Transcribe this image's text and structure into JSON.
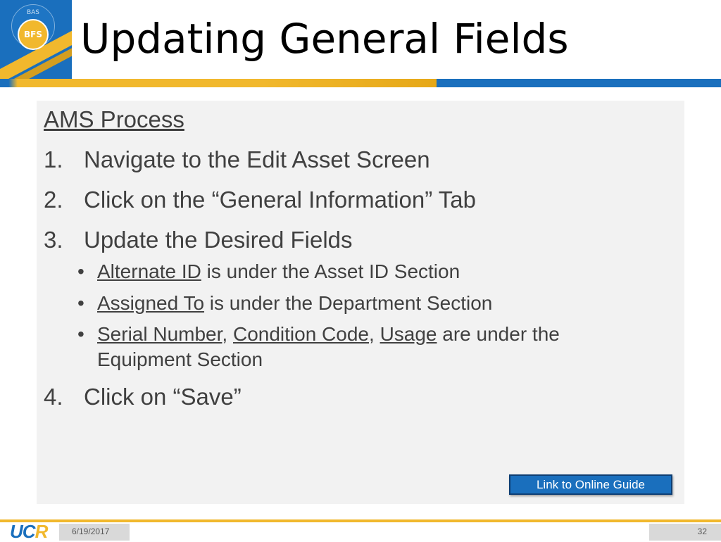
{
  "logo": {
    "small_text": "BAS",
    "badge_text": "BFS"
  },
  "slide": {
    "title": "Updating General Fields",
    "heading": "AMS Process",
    "steps": [
      {
        "num": "1.",
        "text": "Navigate to the Edit Asset Screen"
      },
      {
        "num": "2.",
        "text": "Click on the “General Information” Tab"
      },
      {
        "num": "3.",
        "text": "Update the Desired Fields"
      },
      {
        "num": "4.",
        "text": "Click on “Save”"
      }
    ],
    "bullets": [
      {
        "link": "Alternate ID",
        "rest": " is under the Asset ID Section"
      },
      {
        "link": "Assigned To",
        "rest": " is under the Department Section"
      },
      {
        "link1": "Serial Number",
        "sep1": ", ",
        "link2": "Condition Code",
        "sep2": ", ",
        "link3": "Usage",
        "rest": " are under the",
        "line2": "Equipment Section"
      }
    ],
    "link_button": "Link to Online Guide"
  },
  "footer": {
    "brand_main": "UC",
    "brand_accent": "R",
    "date": "6/19/2017",
    "page_number": "32"
  },
  "colors": {
    "brand_blue": "#1a6fbd",
    "brand_gold": "#f1b82d",
    "panel_bg": "#f2f2f2",
    "text": "#404040"
  }
}
